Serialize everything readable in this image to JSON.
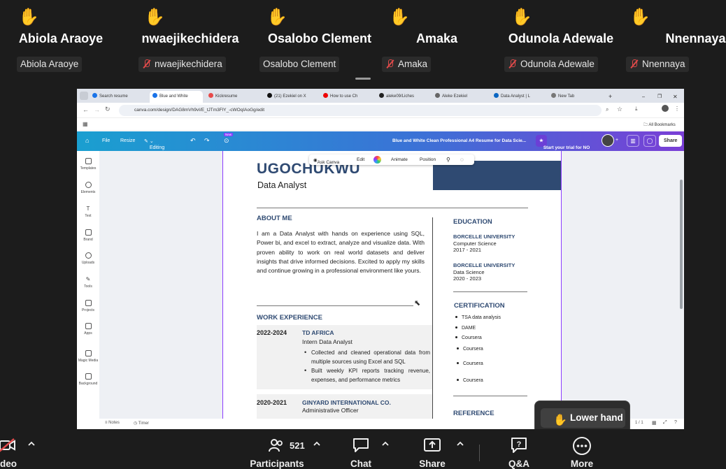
{
  "participants": [
    {
      "name": "Abiola Araoye",
      "tag": "Abiola Araoye",
      "muted": false
    },
    {
      "name": "nwaejikechidera",
      "tag": "nwaejikechidera",
      "muted": true
    },
    {
      "name": "Osalobo Clement",
      "tag": "Osalobo Clement",
      "muted": false
    },
    {
      "name": "Amaka",
      "tag": "Amaka",
      "muted": true
    },
    {
      "name": "Odunola Adewale",
      "tag": "Odunola Adewale",
      "muted": true
    },
    {
      "name": "Nnennaya",
      "tag": "Nnennaya",
      "muted": true
    }
  ],
  "browser": {
    "tabs": [
      "Search resume",
      "Blue and White",
      "Kickresume",
      "(21) Ezekiel on X",
      "How to use Ch",
      "aleke09/Liches",
      "Aleke Ezekiel",
      "Data Analyst | L",
      "New Tab"
    ],
    "url": "canva.com/design/DAG8mVh9vI/E_tJTm3FlY_-cWOqIAoGg/edit",
    "bookmarks_label": "All Bookmarks"
  },
  "canva": {
    "menu": [
      "File",
      "Resize",
      "Editing"
    ],
    "new_badge": "New",
    "doc_title": "Blue and White Clean Professional A4 Resume for Data Scie...",
    "trial": "Start your trial for NO",
    "share": "Share",
    "sidebar": [
      "Templates",
      "Elements",
      "Text",
      "Brand",
      "Uploads",
      "Tools",
      "Projects",
      "Apps",
      "Magic Media",
      "Background"
    ],
    "float_toolbar": [
      "Ask Canva",
      "Edit",
      "Animate",
      "Position"
    ],
    "status": {
      "notes": "Notes",
      "timer": "Timer",
      "pages": "1 / 1"
    }
  },
  "resume": {
    "name": "UGOCHUKWU",
    "role": "Data Analyst",
    "about_heading": "ABOUT ME",
    "about_text": "I am a Data Analyst with hands on experience using SQL, Power bi, and excel to extract, analyze and visualize data. With proven ability to work on real world datasets and deliver insights that drive informed decisions. Excited to apply my skills and continue growing in a professional environment like yours.",
    "work_heading": "WORK EXPERIENCE",
    "jobs": [
      {
        "years": "2022-2024",
        "company": "TD AFRICA",
        "role": "Intern Data Analyst",
        "bullets": [
          "Collected and cleaned operational data from multiple sources using Excel and SQL",
          "Built weekly KPI reports tracking revenue, expenses, and performance metrics"
        ]
      },
      {
        "years": "2020-2021",
        "company": "GINYARD INTERNATIONAL CO.",
        "role": "Administrative Officer",
        "bullets": []
      }
    ],
    "education_heading": "EDUCATION",
    "education": [
      {
        "school": "BORCELLE UNIVERSITY",
        "field": "Computer Science",
        "years": "2017 - 2021"
      },
      {
        "school": "BORCELLE UNIVERSITY",
        "field": "Data Science",
        "years": "2020 - 2023"
      }
    ],
    "cert_heading": "CERTIFICATION",
    "certs": [
      "TSA data analysis",
      "DAME",
      "Coursera",
      "Coursera",
      "Coursera",
      "Coursera"
    ],
    "reference_heading": "REFERENCE"
  },
  "meeting": {
    "lower_hand": "Lower hand",
    "video_label": "deo",
    "participants_label": "Participants",
    "participants_count": "521",
    "chat_label": "Chat",
    "share_label": "Share",
    "qa_label": "Q&A",
    "more_label": "More"
  },
  "colors": {
    "canva_accent": "#8b3dff",
    "resume_blue": "#2f4a72",
    "hand": "#f5b800",
    "mute_red": "#e04a4a"
  }
}
